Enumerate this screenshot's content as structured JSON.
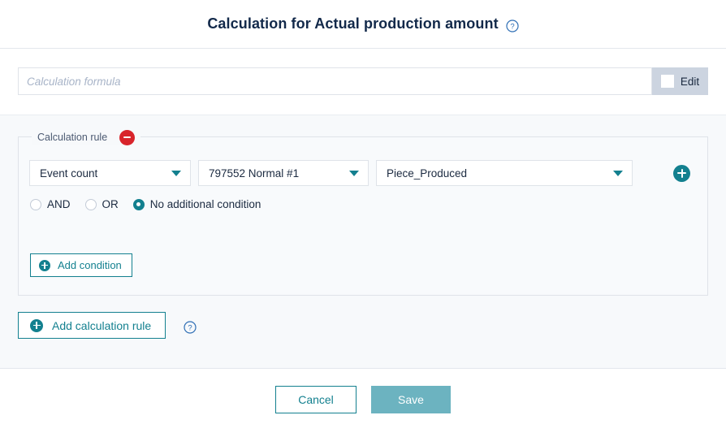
{
  "header": {
    "title": "Calculation for Actual production amount",
    "help_icon": "help-circle-icon"
  },
  "formula": {
    "placeholder": "Calculation formula",
    "value": "",
    "edit_label": "Edit",
    "edit_icon": "edit-square-icon"
  },
  "rule": {
    "legend": "Calculation rule",
    "remove_icon": "minus-circle-icon",
    "selects": [
      {
        "name": "aggregation",
        "value": "Event count",
        "caret": "chevron-down-icon"
      },
      {
        "name": "source",
        "value": "797552 Normal #1",
        "caret": "chevron-down-icon"
      },
      {
        "name": "metric",
        "value": "Piece_Produced",
        "caret": "chevron-down-icon"
      }
    ],
    "add_row_icon": "plus-circle-icon",
    "conditions": [
      {
        "label": "AND",
        "selected": false
      },
      {
        "label": "OR",
        "selected": false
      },
      {
        "label": "No additional condition",
        "selected": true
      }
    ],
    "add_condition_label": "Add condition",
    "add_condition_icon": "plus-circle-icon"
  },
  "add_rule": {
    "label": "Add calculation rule",
    "icon": "plus-circle-icon",
    "help_icon": "help-circle-icon"
  },
  "footer": {
    "cancel_label": "Cancel",
    "save_label": "Save"
  },
  "colors": {
    "teal": "#13808f",
    "teal_muted": "#6cb3c0",
    "red": "#d8242b",
    "title_navy": "#12294a",
    "help_blue": "#2f6fb5",
    "section_bg": "#f7f9fb",
    "edit_bg": "#ccd4e0"
  }
}
